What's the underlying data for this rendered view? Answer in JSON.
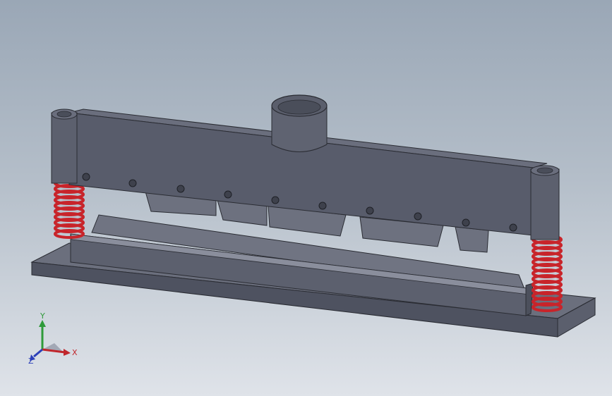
{
  "viewport": {
    "background_top": "#9aa7b6",
    "background_bottom": "#dfe3e9"
  },
  "model": {
    "parts": [
      "base-plate",
      "lower-die",
      "upper-beam",
      "punch-blocks",
      "guide-posts",
      "springs",
      "cylinder-mount"
    ],
    "colors": {
      "body": "#585c6b",
      "body_light": "#6a6e7d",
      "spring": "#c8242a",
      "edge": "#2a2c33"
    }
  },
  "triad": {
    "x_label": "X",
    "y_label": "Y",
    "z_label": "Z",
    "x_color": "#c0262c",
    "y_color": "#2f9a3a",
    "z_color": "#2b3fb8"
  }
}
